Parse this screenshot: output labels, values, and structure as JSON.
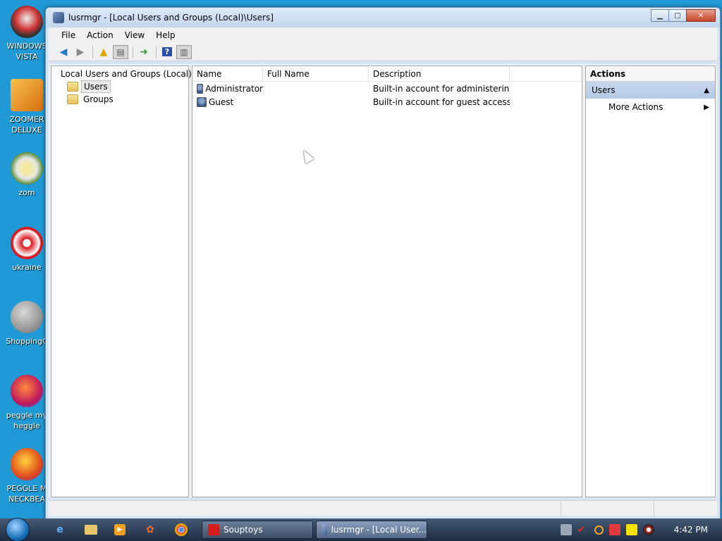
{
  "colors": {
    "desktop": "#1f9ad6",
    "window_chrome": "#d6e5f5",
    "actions_group": "#c8d8ee",
    "taskbar": "#1d2c42"
  },
  "desktop_icons": [
    {
      "label": "WINDOWS VISTA",
      "icon": "vista-icon"
    },
    {
      "label": "ZOOMER DELUXE",
      "icon": "zoomer-icon"
    },
    {
      "label": "zom",
      "icon": "flower-icon"
    },
    {
      "label": "ukraine",
      "icon": "radiation-icon"
    },
    {
      "label": "ShoppingC",
      "icon": "flash-icon"
    },
    {
      "label": "peggle my heggle",
      "icon": "peggle-icon"
    },
    {
      "label": "PEGGLE M NECKBEA",
      "icon": "peggle-icon"
    }
  ],
  "window": {
    "title": "lusrmgr - [Local Users and Groups (Local)\\Users]",
    "menu": [
      "File",
      "Action",
      "View",
      "Help"
    ]
  },
  "toolbar_icons": [
    "back-arrow-icon",
    "forward-arrow-icon",
    "up-folder-icon",
    "show-tree-icon",
    "export-list-icon",
    "help-icon",
    "show-action-pane-icon"
  ],
  "tree": {
    "root": "Local Users and Groups (Local)",
    "items": [
      "Users",
      "Groups"
    ],
    "selected": "Users"
  },
  "list": {
    "columns": [
      "Name",
      "Full Name",
      "Description"
    ],
    "rows": [
      {
        "name": "Administrator",
        "full_name": "",
        "description": "Built-in account for administering..."
      },
      {
        "name": "Guest",
        "full_name": "",
        "description": "Built-in account for guest access t..."
      }
    ]
  },
  "actions": {
    "title": "Actions",
    "group": "Users",
    "items": [
      "More Actions"
    ]
  },
  "taskbar": {
    "quick_launch": [
      "internet-explorer-icon",
      "folder-icon",
      "media-player-icon",
      "puzzle-icon",
      "chrome-icon"
    ],
    "tasks": [
      {
        "label": "Souptoys",
        "active": false
      },
      {
        "label": "lusrmgr - [Local User...",
        "active": true
      }
    ],
    "clock": "4:42 PM"
  }
}
